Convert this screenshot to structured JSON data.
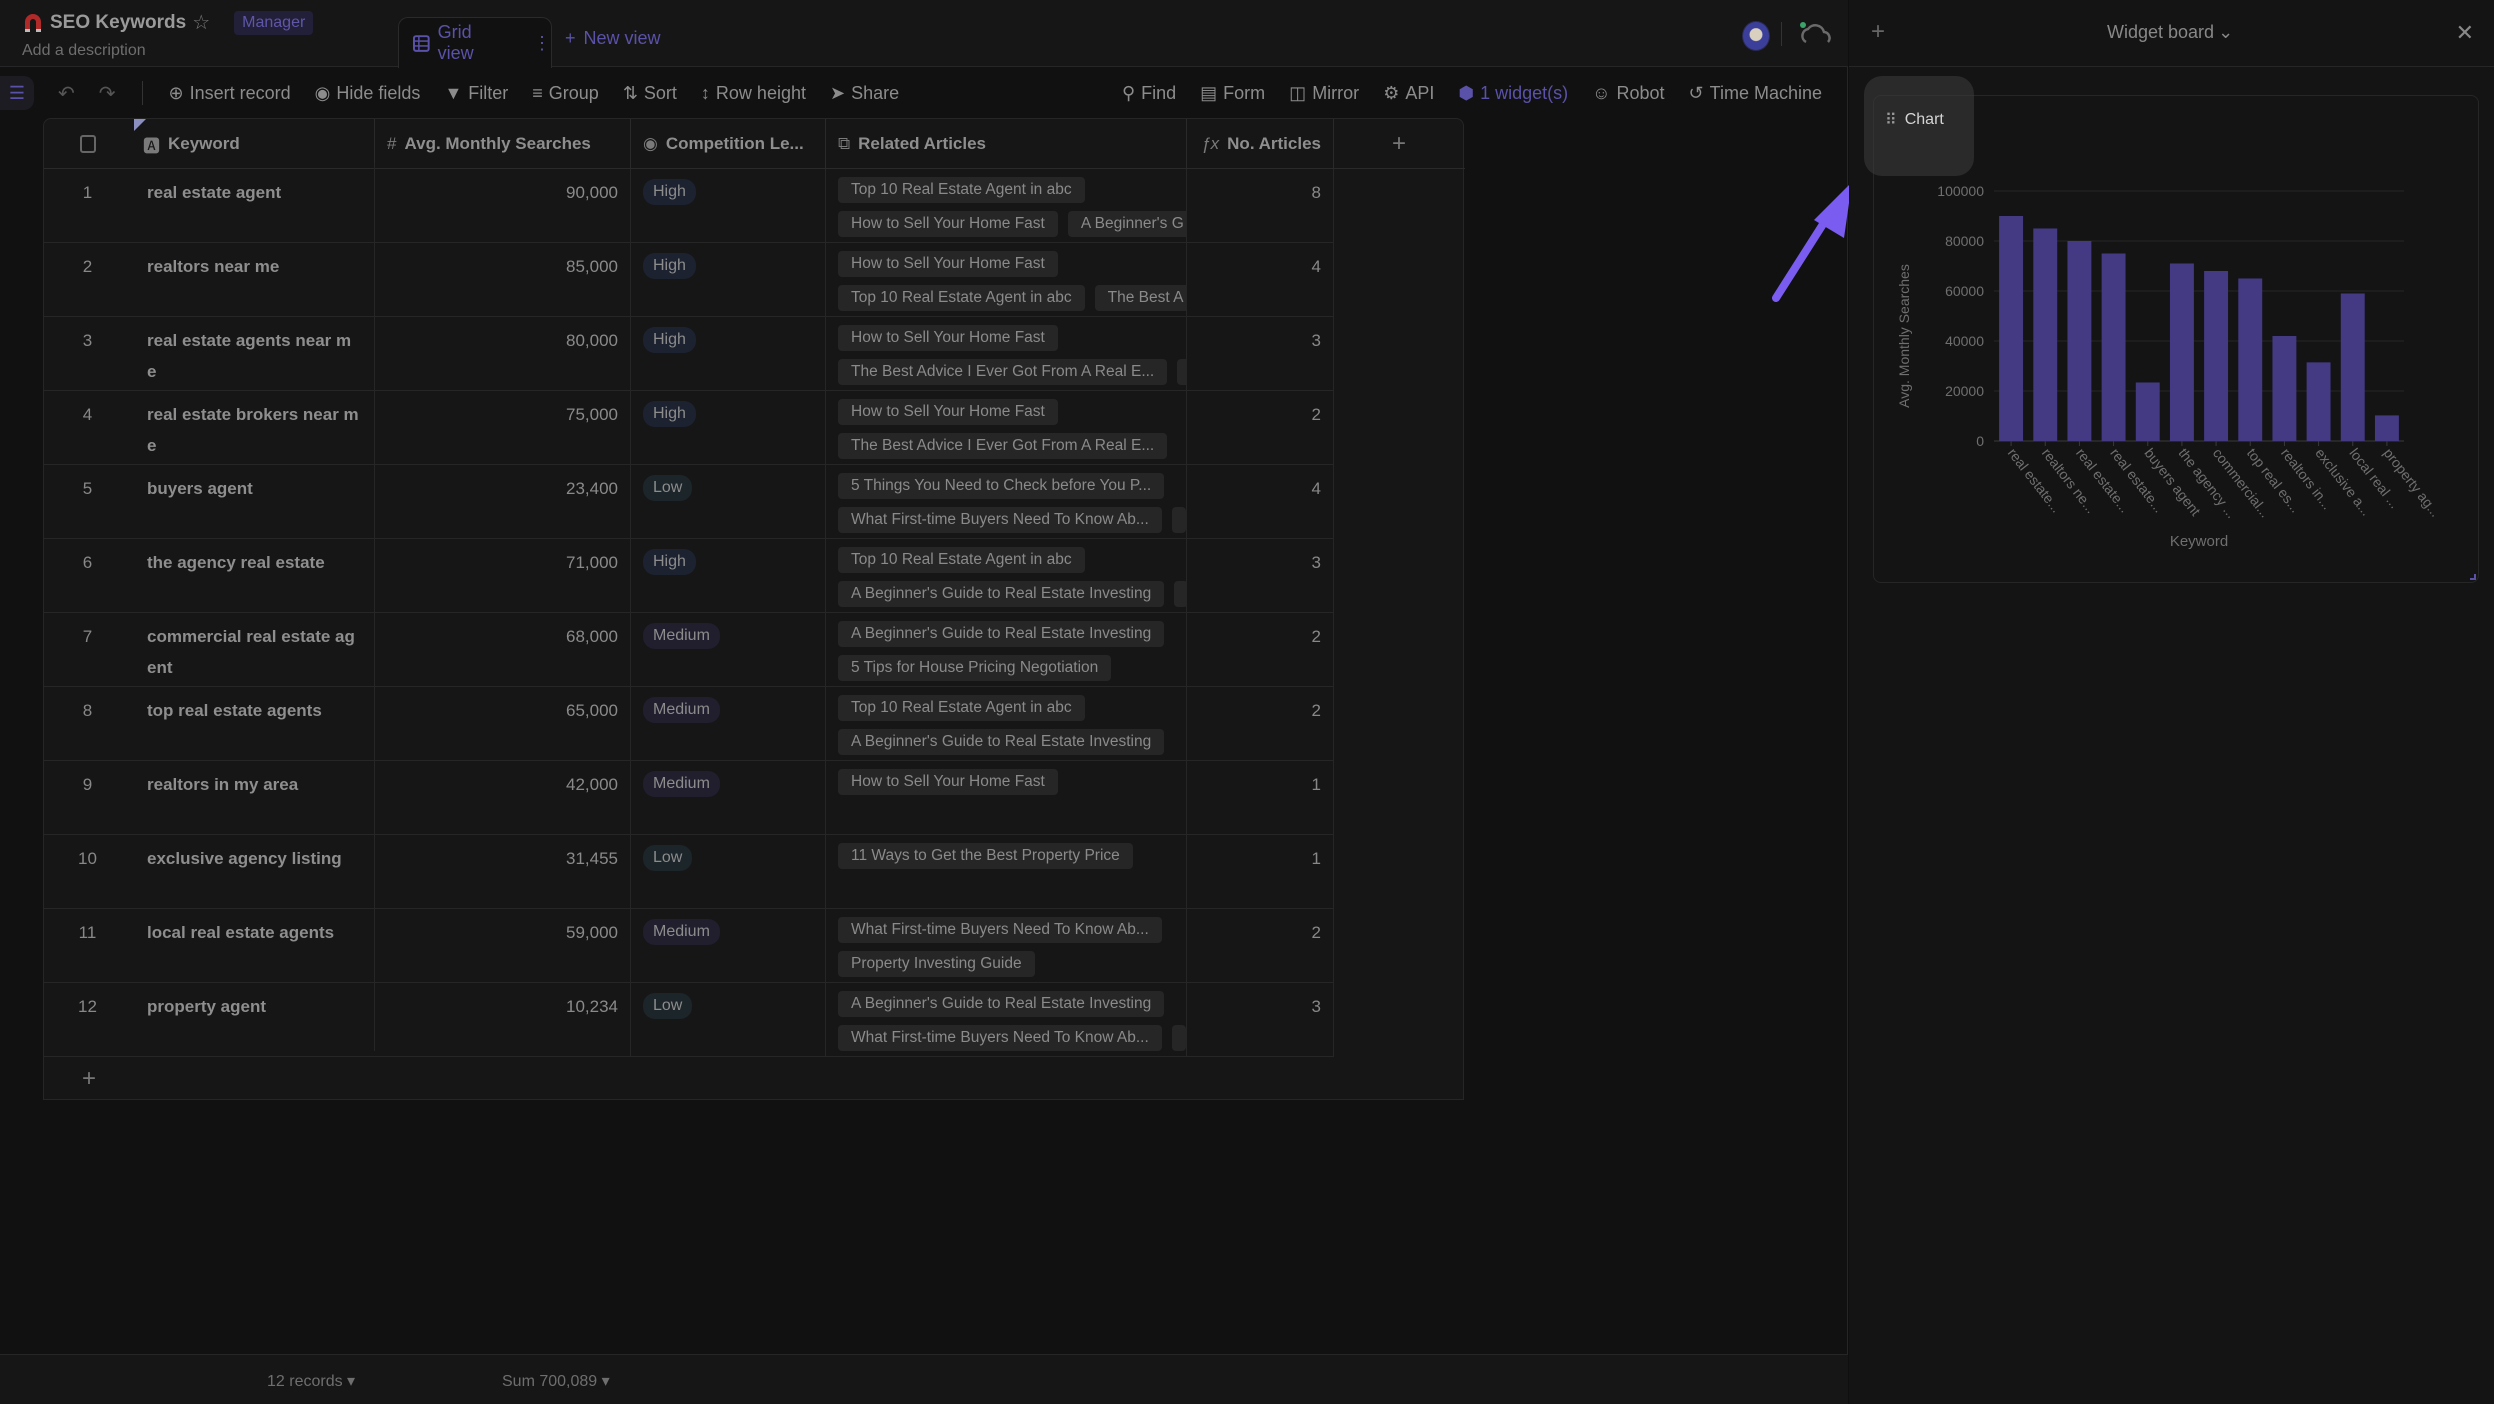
{
  "header": {
    "title": "SEO Keywords",
    "role_badge": "Manager",
    "description": "Add a description",
    "view_tab": "Grid view",
    "new_view": "New view"
  },
  "toolbar": {
    "insert_record": "Insert record",
    "hide_fields": "Hide fields",
    "filter": "Filter",
    "group": "Group",
    "sort": "Sort",
    "row_height": "Row height",
    "share": "Share",
    "find": "Find",
    "form": "Form",
    "mirror": "Mirror",
    "api": "API",
    "widgets": "1 widget(s)",
    "robot": "Robot",
    "time_machine": "Time Machine"
  },
  "columns": {
    "keyword": "Keyword",
    "avg": "Avg. Monthly Searches",
    "competition": "Competition Le...",
    "related": "Related Articles",
    "num": "No. Articles"
  },
  "rows": [
    {
      "idx": "1",
      "keyword": "real estate agent",
      "avg": "90,000",
      "comp": "High",
      "lines": [
        [
          "Top 10 Real Estate Agent in abc"
        ],
        [
          "How to Sell Your Home Fast",
          "A Beginner's G"
        ]
      ],
      "num": "8"
    },
    {
      "idx": "2",
      "keyword": "realtors near me",
      "avg": "85,000",
      "comp": "High",
      "lines": [
        [
          "How to Sell Your Home Fast"
        ],
        [
          "Top 10 Real Estate Agent in abc",
          "The Best A"
        ]
      ],
      "num": "4"
    },
    {
      "idx": "3",
      "keyword": "real estate agents near me",
      "avg": "80,000",
      "comp": "High",
      "lines": [
        [
          "How to Sell Your Home Fast"
        ],
        [
          "The Best Advice I Ever Got From A Real E...",
          ""
        ]
      ],
      "num": "3"
    },
    {
      "idx": "4",
      "keyword": "real estate brokers near me",
      "avg": "75,000",
      "comp": "High",
      "lines": [
        [
          "How to Sell Your Home Fast"
        ],
        [
          "The Best Advice I Ever Got From A Real E..."
        ]
      ],
      "num": "2"
    },
    {
      "idx": "5",
      "keyword": "buyers agent",
      "avg": "23,400",
      "comp": "Low",
      "lines": [
        [
          "5 Things You Need to Check before You P..."
        ],
        [
          "What First-time Buyers Need To Know Ab...",
          ""
        ]
      ],
      "num": "4"
    },
    {
      "idx": "6",
      "keyword": "the agency real estate",
      "avg": "71,000",
      "comp": "High",
      "lines": [
        [
          "Top 10 Real Estate Agent in abc"
        ],
        [
          "A Beginner's Guide to Real Estate Investing",
          ""
        ]
      ],
      "num": "3"
    },
    {
      "idx": "7",
      "keyword": "commercial real estate agent",
      "avg": "68,000",
      "comp": "Medium",
      "lines": [
        [
          "A Beginner's Guide to Real Estate Investing"
        ],
        [
          "5 Tips for House Pricing Negotiation"
        ]
      ],
      "num": "2"
    },
    {
      "idx": "8",
      "keyword": "top real estate agents",
      "avg": "65,000",
      "comp": "Medium",
      "lines": [
        [
          "Top 10 Real Estate Agent in abc"
        ],
        [
          "A Beginner's Guide to Real Estate Investing"
        ]
      ],
      "num": "2"
    },
    {
      "idx": "9",
      "keyword": "realtors in my area",
      "avg": "42,000",
      "comp": "Medium",
      "lines": [
        [
          "How to Sell Your Home Fast"
        ]
      ],
      "num": "1"
    },
    {
      "idx": "10",
      "keyword": "exclusive agency listing",
      "avg": "31,455",
      "comp": "Low",
      "lines": [
        [
          "11 Ways to Get the Best Property Price"
        ]
      ],
      "num": "1"
    },
    {
      "idx": "11",
      "keyword": "local real estate agents",
      "avg": "59,000",
      "comp": "Medium",
      "lines": [
        [
          "What First-time Buyers Need To Know Ab..."
        ],
        [
          "Property Investing Guide"
        ]
      ],
      "num": "2"
    },
    {
      "idx": "12",
      "keyword": "property agent",
      "avg": "10,234",
      "comp": "Low",
      "lines": [
        [
          "A Beginner's Guide to Real Estate Investing"
        ],
        [
          "What First-time Buyers Need To Know Ab...",
          ""
        ]
      ],
      "num": "3"
    }
  ],
  "footer": {
    "records": "12 records ▾",
    "sum": "Sum 700,089 ▾"
  },
  "panel": {
    "title": "Widget board",
    "widget_title": "Chart"
  },
  "colors": {
    "accent": "#5a52a8",
    "bar": "#433a83",
    "arrow": "#7a5cf0"
  },
  "chart_data": {
    "type": "bar",
    "title": "",
    "xlabel": "Keyword",
    "ylabel": "Avg. Monthly Searches",
    "ylim": [
      0,
      100000
    ],
    "yticks": [
      0,
      20000,
      40000,
      60000,
      80000,
      100000
    ],
    "grid": true,
    "categories": [
      "real estate...",
      "realtors ne...",
      "real estate...",
      "real estate...",
      "buyers agent",
      "the agency ...",
      "commercial...",
      "top real es...",
      "realtors in...",
      "exclusive a...",
      "local real ...",
      "property ag..."
    ],
    "values": [
      90000,
      85000,
      80000,
      75000,
      23400,
      71000,
      68000,
      65000,
      42000,
      31455,
      59000,
      10234
    ]
  }
}
